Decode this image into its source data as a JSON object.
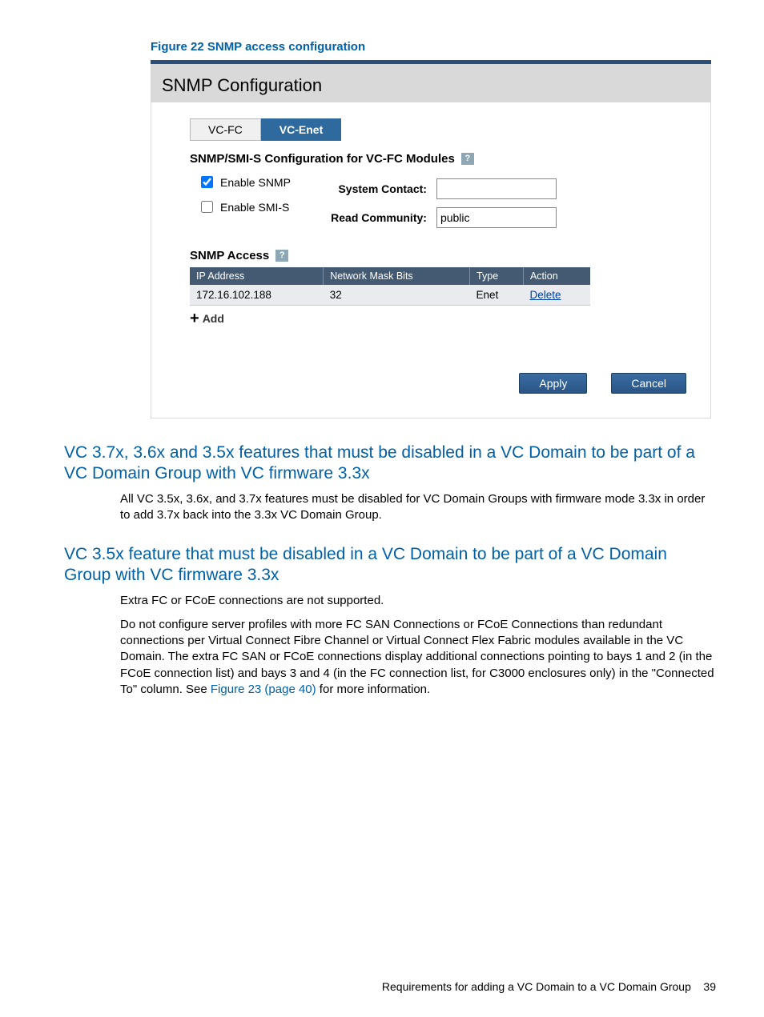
{
  "figure_caption": "Figure 22 SNMP access configuration",
  "panel": {
    "title": "SNMP Configuration",
    "tabs": {
      "vcfc": "VC-FC",
      "vcenet": "VC-Enet"
    },
    "module_section_title": "SNMP/SMI-S Configuration for VC-FC Modules",
    "checkboxes": {
      "enable_snmp": "Enable SNMP",
      "enable_smis": "Enable SMI-S"
    },
    "fields": {
      "system_contact_label": "System Contact:",
      "system_contact_value": "",
      "read_community_label": "Read Community:",
      "read_community_value": "public"
    },
    "access_title": "SNMP Access",
    "access_headers": {
      "ip": "IP Address",
      "mask": "Network Mask Bits",
      "type": "Type",
      "action": "Action"
    },
    "access_rows": [
      {
        "ip": "172.16.102.188",
        "mask": "32",
        "type": "Enet",
        "action": "Delete"
      }
    ],
    "add_label": "Add",
    "buttons": {
      "apply": "Apply",
      "cancel": "Cancel"
    }
  },
  "heading1": "VC 3.7x, 3.6x and 3.5x features that must be disabled in a VC Domain to be part of a VC Domain Group with VC firmware 3.3x",
  "para1": "All VC 3.5x, 3.6x, and 3.7x features must be disabled for VC Domain Groups with firmware mode 3.3x in order to add 3.7x back into the 3.3x VC Domain Group.",
  "heading2": "VC 3.5x feature that must be disabled in a VC Domain to be part of a VC Domain Group with VC firmware 3.3x",
  "para2a": "Extra FC or FCoE connections are not supported.",
  "para2b_pre": "Do not configure server profiles with more FC SAN Connections or FCoE Connections than redundant connections per Virtual Connect Fibre Channel or Virtual Connect Flex Fabric modules available in the VC Domain. The extra FC SAN or FCoE connections display additional connections pointing to bays 1 and 2 (in the FCoE connection list) and bays 3 and 4 (in the FC connection list, for C3000 enclosures only) in the \"Connected To\" column. See ",
  "para2b_link": "Figure 23 (page 40)",
  "para2b_post": " for more information.",
  "footer_text": "Requirements for adding a VC Domain to a VC Domain Group",
  "footer_page": "39"
}
